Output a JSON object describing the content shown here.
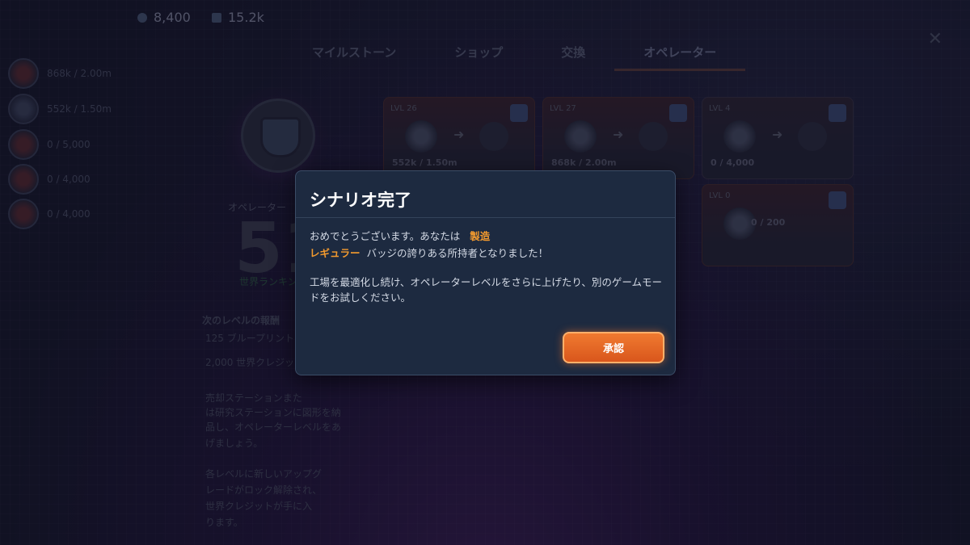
{
  "resources": {
    "coins": "8,400",
    "parts": "15.2k"
  },
  "tabs": [
    "マイルストーン",
    "ショップ",
    "交換",
    "オペレーター"
  ],
  "active_tab": 3,
  "left_list": [
    {
      "value": "868k / 2.00m"
    },
    {
      "value": "552k / 1.50m"
    },
    {
      "value": "0 / 5,000"
    },
    {
      "value": "0 / 4,000"
    },
    {
      "value": "0 / 4,000"
    }
  ],
  "operator": {
    "label": "オペレーター",
    "level": "51",
    "rank_text": "世界ランキング"
  },
  "next_reward": {
    "title": "次のレベルの報酬",
    "reward1": "125 ブループリント",
    "reward2": "2,000 世界クレジット"
  },
  "background_text": [
    "売却ステーションまた",
    "は研究ステーションに図形を納",
    "品し、オペレーターレベルをあ",
    "げましょう。",
    "各レベルに新しいアップグ",
    "レードがロック解除され、",
    "世界クレジットが手に入",
    "ります。"
  ],
  "cards": [
    {
      "lv": "LVL 26",
      "value": "552k / 1.50m"
    },
    {
      "lv": "LVL 27",
      "value": "868k / 2.00m"
    },
    {
      "lv": "LVL 4",
      "value": "0 / 4,000"
    },
    {
      "lv": "LVL 0",
      "value": "0 / 200"
    }
  ],
  "modal": {
    "title": "シナリオ完了",
    "p1_prefix": "おめでとうございます。あなたは",
    "badge_name_1": "製造",
    "badge_name_2": "レギュラー",
    "p1_suffix": "バッジの誇りある所持者となりました！",
    "p2": "工場を最適化し続け、オペレーターレベルをさらに上げたり、別のゲームモードをお試しください。",
    "confirm_label": "承認"
  },
  "colors": {
    "accent": "#f07a30",
    "highlight": "#f39a2e",
    "modal_bg": "#1d2a40"
  }
}
